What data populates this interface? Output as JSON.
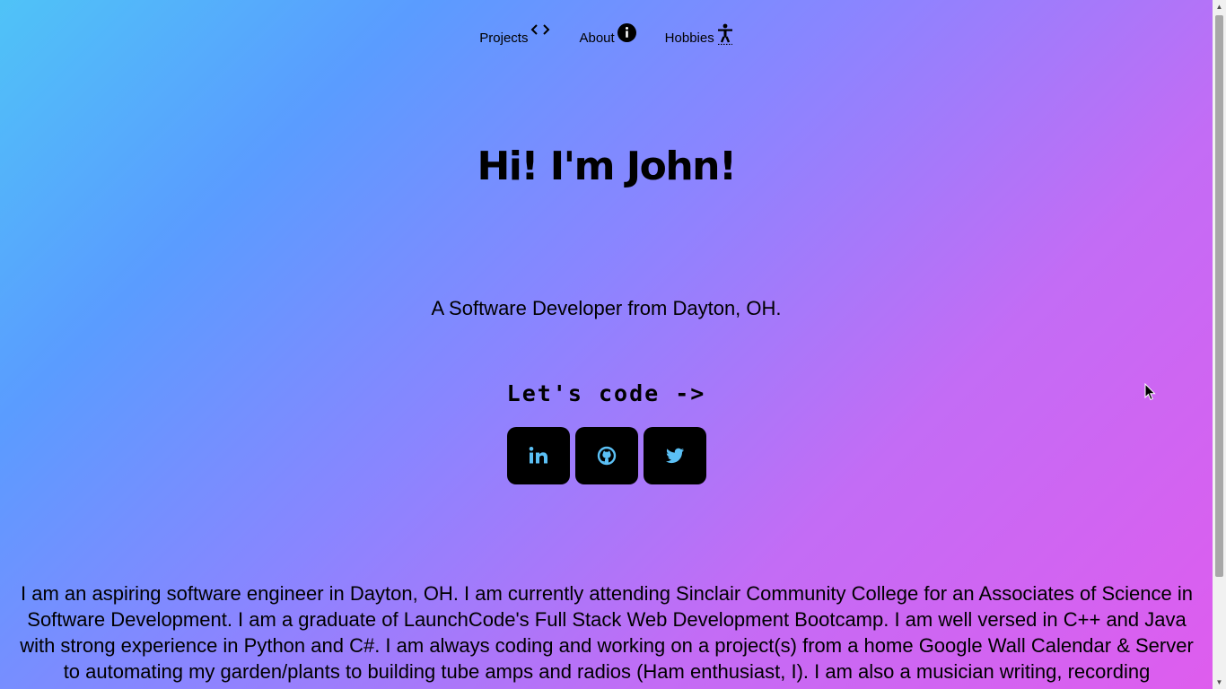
{
  "nav": {
    "items": [
      {
        "label": "Projects",
        "icon": "code-icon"
      },
      {
        "label": "About",
        "icon": "info-icon"
      },
      {
        "label": "Hobbies",
        "icon": "accessibility-icon"
      }
    ]
  },
  "hero": {
    "title": "Hi! I'm John!",
    "tagline": "A Software Developer from Dayton, OH.",
    "cta": "Let's code ->"
  },
  "social": {
    "icon_color": "#5bc0f5",
    "items": [
      "linkedin-icon",
      "github-icon",
      "twitter-icon"
    ]
  },
  "bio": {
    "text": "I am an aspiring software engineer in Dayton, OH. I am currently attending Sinclair Community College for an Associates of Science in Software Development. I am a graduate of LaunchCode's Full Stack Web Development Bootcamp. I am well versed in C++ and Java with strong experience in Python and C#. I am always coding and working on a project(s) from a home Google Wall Calendar & Server to automating my garden/plants to building tube amps and radios (Ham enthusiast, I). I am also a musician writing, recording"
  },
  "colors": {
    "gradient_start": "#4fc3f7",
    "gradient_end": "#df5cee",
    "button_bg": "#000000"
  }
}
